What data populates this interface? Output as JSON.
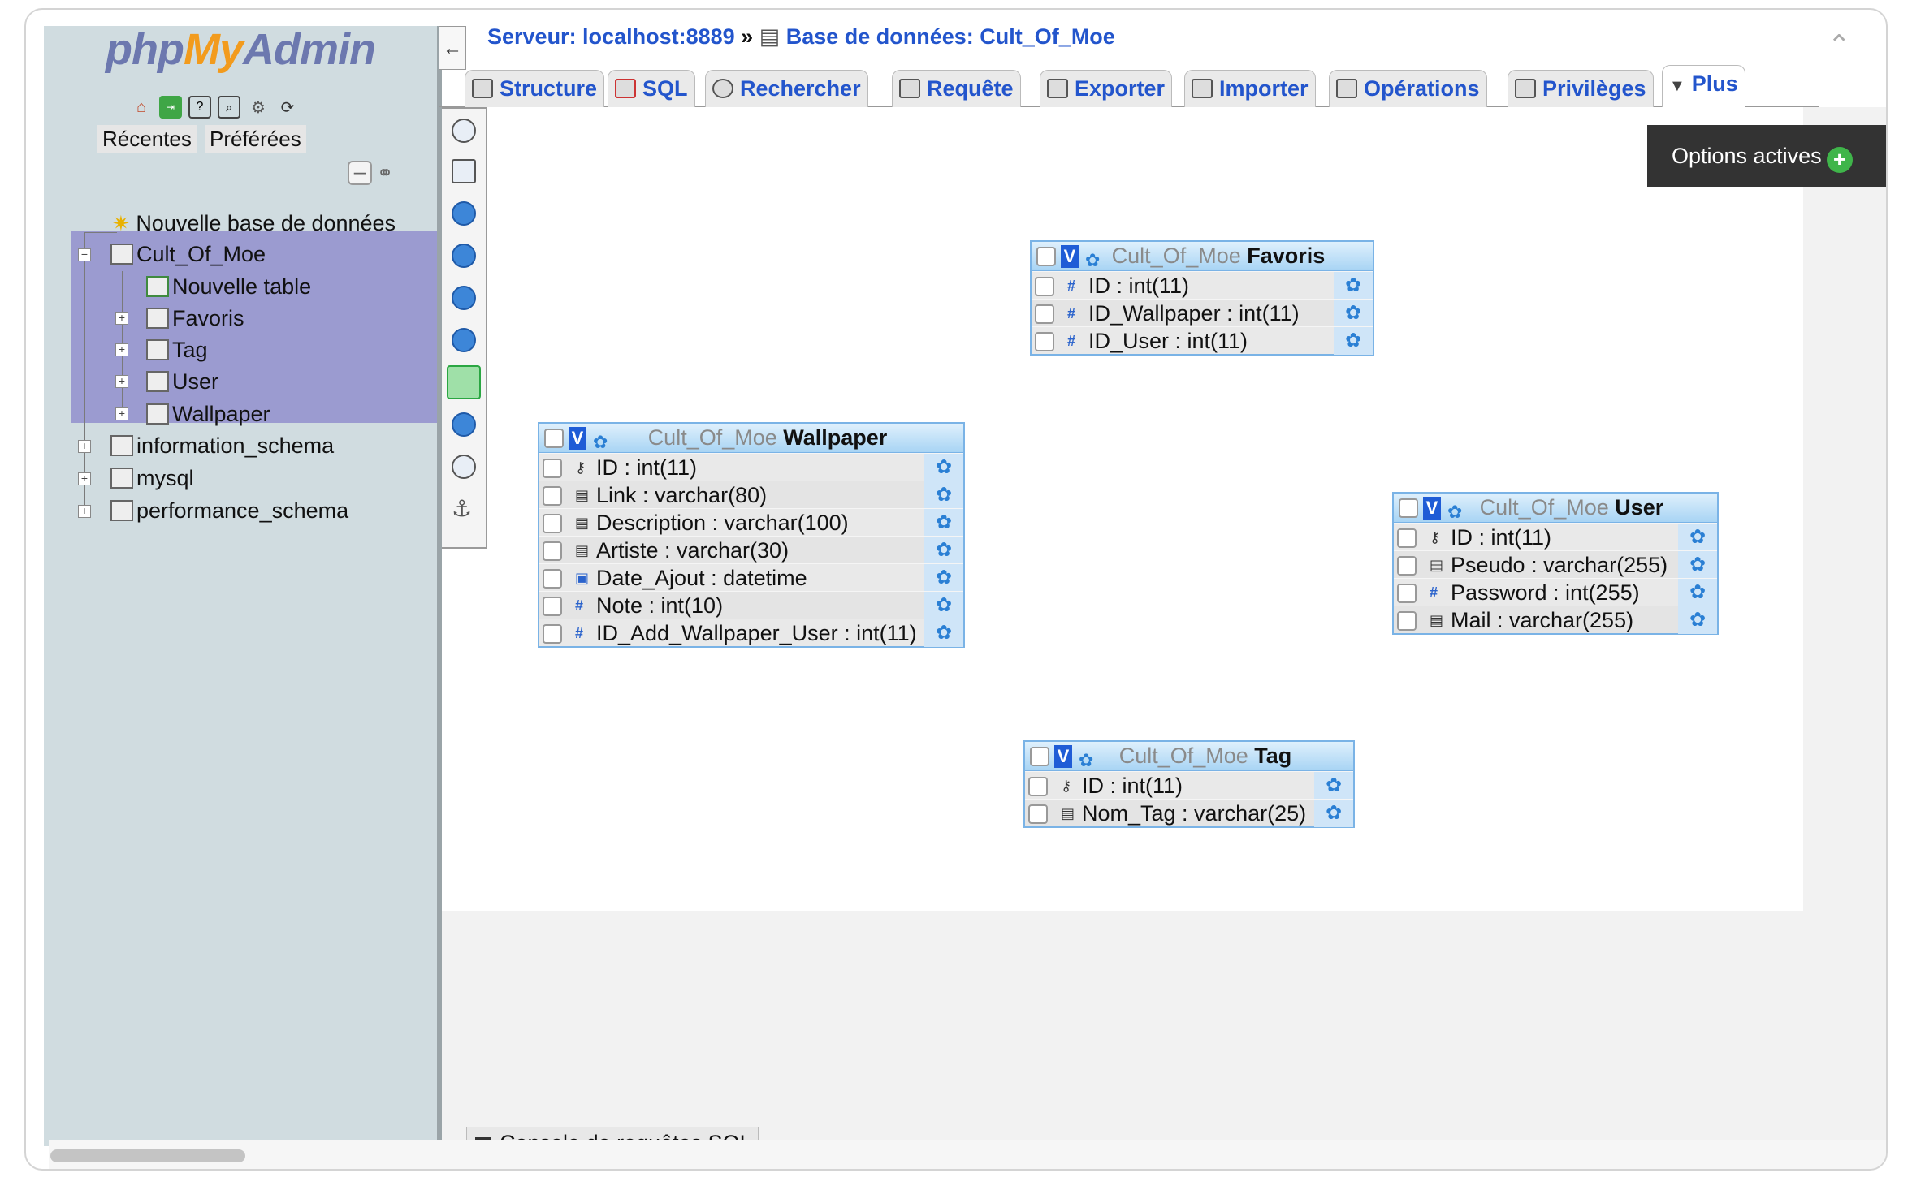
{
  "logo": {
    "part1": "php",
    "part2": "My",
    "part3": "Admin"
  },
  "sidebar": {
    "recent_label": "Récentes",
    "favorites_label": "Préférées",
    "tree": [
      {
        "label": "Nouvelle base de données"
      },
      {
        "label": "Cult_Of_Moe"
      },
      {
        "label": "Nouvelle table"
      },
      {
        "label": "Favoris"
      },
      {
        "label": "Tag"
      },
      {
        "label": "User"
      },
      {
        "label": "Wallpaper"
      },
      {
        "label": "information_schema"
      },
      {
        "label": "mysql"
      },
      {
        "label": "performance_schema"
      }
    ]
  },
  "breadcrumb": {
    "server": "Serveur: localhost:8889",
    "separator": "»",
    "database": "Base de données: Cult_Of_Moe"
  },
  "tabs": [
    {
      "label": "Structure"
    },
    {
      "label": "SQL"
    },
    {
      "label": "Rechercher"
    },
    {
      "label": "Requête"
    },
    {
      "label": "Exporter"
    },
    {
      "label": "Importer"
    },
    {
      "label": "Opérations"
    },
    {
      "label": "Privilèges"
    },
    {
      "label": "Plus",
      "active": true
    }
  ],
  "options_button": {
    "label": "Options actives"
  },
  "designer_tables": [
    {
      "db": "Cult_Of_Moe",
      "name": "Favoris",
      "columns": [
        {
          "icon": "hash",
          "label": "ID : int(11)"
        },
        {
          "icon": "hash",
          "label": "ID_Wallpaper : int(11)"
        },
        {
          "icon": "hash",
          "label": "ID_User : int(11)"
        }
      ]
    },
    {
      "db": "Cult_Of_Moe",
      "name": "Wallpaper",
      "columns": [
        {
          "icon": "key",
          "label": "ID : int(11)"
        },
        {
          "icon": "text",
          "label": "Link : varchar(80)"
        },
        {
          "icon": "text",
          "label": "Description : varchar(100)"
        },
        {
          "icon": "text",
          "label": "Artiste : varchar(30)"
        },
        {
          "icon": "date",
          "label": "Date_Ajout : datetime"
        },
        {
          "icon": "hash",
          "label": "Note : int(10)"
        },
        {
          "icon": "hash",
          "label": "ID_Add_Wallpaper_User : int(11)"
        }
      ]
    },
    {
      "db": "Cult_Of_Moe",
      "name": "User",
      "columns": [
        {
          "icon": "key",
          "label": "ID : int(11)"
        },
        {
          "icon": "text",
          "label": "Pseudo : varchar(255)"
        },
        {
          "icon": "hash",
          "label": "Password : int(255)"
        },
        {
          "icon": "text",
          "label": "Mail : varchar(255)"
        }
      ]
    },
    {
      "db": "Cult_Of_Moe",
      "name": "Tag",
      "columns": [
        {
          "icon": "key",
          "label": "ID : int(11)"
        },
        {
          "icon": "text",
          "label": "Nom_Tag : varchar(25)"
        }
      ]
    }
  ],
  "console": {
    "label": "Console de requêtes SQL"
  },
  "colors": {
    "link": "#2355cc",
    "highlight": "#9b9bd0",
    "sidebar": "#d0dce0",
    "header": "#a8d4f4"
  }
}
